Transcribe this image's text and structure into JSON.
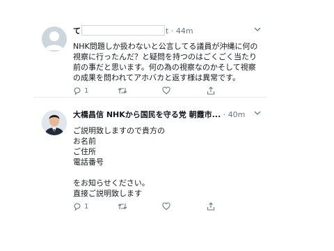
{
  "tweets": [
    {
      "name": "て",
      "handle_suffix": "t",
      "time": "44m",
      "text": "NHK問題しか扱わないと公言してる議員が沖縄に何の\n視察に行ったんだ？と疑問を持つのはごくごく当たり\n前の事だと思います。何の為の視察なのかそして視察\nの成果を問われてアホバカと返す様は異常です。",
      "reply_count": "1",
      "retweet_count": "",
      "like_count": ""
    },
    {
      "name": "大橋昌信 NHKから国民を守る党 朝霞市...",
      "time": "40m",
      "text": "ご説明致しますので貴方の\nお名前\nご住所\n電話番号\n\nをお知らせください。\n直接ご説明致します",
      "reply_count": "1",
      "retweet_count": "",
      "like_count": ""
    }
  ],
  "separator": "·",
  "icons": [
    "avatar-silhouette-icon",
    "chevron-down-icon",
    "reply-icon",
    "retweet-icon",
    "like-icon",
    "share-icon"
  ],
  "colors": {
    "muted": "#657786",
    "divider": "#e6ecf0",
    "text": "#14171a"
  }
}
